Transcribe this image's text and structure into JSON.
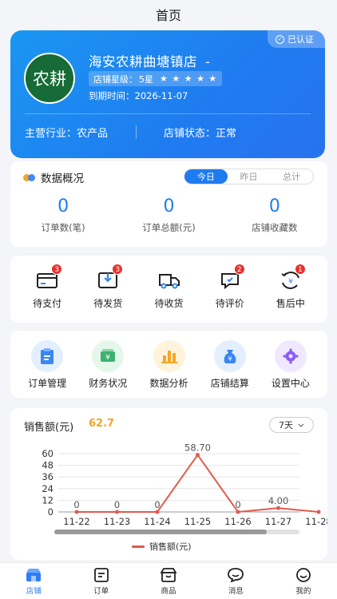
{
  "header": {
    "title": "首页"
  },
  "shop": {
    "verified": "已认证",
    "logo_text": "农耕",
    "name": "海安农耕曲塘镇店",
    "name_suffix": "-",
    "rating_label": "店铺星级：",
    "rating_value": "5星",
    "stars": "★ ★ ★ ★ ★",
    "expire_label": "到期时间：",
    "expire_value": "2026-11-07",
    "industry_label": "主营行业：",
    "industry_value": "农产品",
    "status_label": "店铺状态：",
    "status_value": "正常"
  },
  "overview": {
    "title": "数据概况",
    "tabs": [
      "今日",
      "昨日",
      "总计"
    ],
    "active_tab": 0,
    "stats": [
      {
        "value": "0",
        "label": "订单数(笔)"
      },
      {
        "value": "0",
        "label": "订单总额(元)"
      },
      {
        "value": "0",
        "label": "店铺收藏数"
      }
    ]
  },
  "orders": {
    "items": [
      {
        "label": "待支付",
        "icon": "wallet-icon",
        "badge": "3"
      },
      {
        "label": "待发货",
        "icon": "package-icon",
        "badge": "3"
      },
      {
        "label": "待收货",
        "icon": "truck-icon",
        "badge": ""
      },
      {
        "label": "待评价",
        "icon": "review-icon",
        "badge": "2"
      },
      {
        "label": "售后中",
        "icon": "refund-icon",
        "badge": "1"
      }
    ]
  },
  "menu": {
    "items": [
      {
        "label": "订单管理",
        "icon": "clipboard-icon",
        "color": "#3a86f4",
        "bg": "#e3efff"
      },
      {
        "label": "财务状况",
        "icon": "money-icon",
        "color": "#3cb371",
        "bg": "#e4f7ea"
      },
      {
        "label": "数据分析",
        "icon": "bar-chart-icon",
        "color": "#f5a623",
        "bg": "#fff3dc"
      },
      {
        "label": "店铺结算",
        "icon": "money-bag-icon",
        "color": "#3a86f4",
        "bg": "#e3efff"
      },
      {
        "label": "设置中心",
        "icon": "gear-icon",
        "color": "#8a5cf6",
        "bg": "#efe8ff"
      }
    ]
  },
  "sales": {
    "title": "销售额(元)",
    "total": "62.7",
    "range": "7天",
    "legend": "销售额(元)"
  },
  "chart_data": {
    "type": "line",
    "categories": [
      "11-22",
      "11-23",
      "11-24",
      "11-25",
      "11-26",
      "11-27",
      "11-28"
    ],
    "series": [
      {
        "name": "销售额(元)",
        "values": [
          0,
          0,
          0,
          58.7,
          0,
          4.0,
          0
        ],
        "labels": [
          "0",
          "0",
          "0",
          "58.70",
          "0",
          "4.00",
          ""
        ]
      }
    ],
    "yticks": [
      0,
      12,
      24,
      36,
      48,
      60
    ],
    "ylim": [
      0,
      60
    ],
    "color": "#e05a4e",
    "grid": true
  },
  "tabbar": {
    "items": [
      {
        "label": "店铺",
        "icon": "store-icon",
        "active": true
      },
      {
        "label": "订单",
        "icon": "order-icon",
        "active": false
      },
      {
        "label": "商品",
        "icon": "goods-icon",
        "active": false
      },
      {
        "label": "消息",
        "icon": "message-icon",
        "active": false
      },
      {
        "label": "我的",
        "icon": "profile-icon",
        "active": false
      }
    ]
  }
}
